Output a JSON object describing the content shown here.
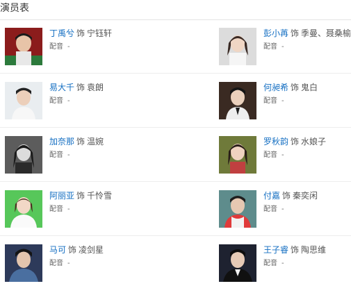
{
  "section": {
    "title": "演员表"
  },
  "cast": [
    {
      "actor": "丁禹兮",
      "plays": "饰",
      "role": "宁钰轩",
      "dub_label": "配音",
      "dub_value": "-",
      "photo_bg": "#8b1c1c"
    },
    {
      "actor": "彭小苒",
      "plays": "饰",
      "role": "季曼、聂桑榆",
      "dub_label": "配音",
      "dub_value": "-",
      "photo_bg": "#dcdcdc"
    },
    {
      "actor": "易大千",
      "plays": "饰",
      "role": "袁朗",
      "dub_label": "配音",
      "dub_value": "-",
      "photo_bg": "#e9edf0"
    },
    {
      "actor": "何昶希",
      "plays": "饰",
      "role": "鬼白",
      "dub_label": "配音",
      "dub_value": "-",
      "photo_bg": "#3a2a22"
    },
    {
      "actor": "加奈那",
      "plays": "饰",
      "role": "温婉",
      "dub_label": "配音",
      "dub_value": "-",
      "photo_bg": "#5c5c5c"
    },
    {
      "actor": "罗秋韵",
      "plays": "饰",
      "role": "水娘子",
      "dub_label": "配音",
      "dub_value": "-",
      "photo_bg": "#6f7a3a"
    },
    {
      "actor": "阿丽亚",
      "plays": "饰",
      "role": "千怜雪",
      "dub_label": "配音",
      "dub_value": "-",
      "photo_bg": "#57c75a"
    },
    {
      "actor": "付嘉",
      "plays": "饰",
      "role": "秦奕闲",
      "dub_label": "配音",
      "dub_value": "-",
      "photo_bg": "#5e8c8c"
    },
    {
      "actor": "马可",
      "plays": "饰",
      "role": "凌剑星",
      "dub_label": "配音",
      "dub_value": "-",
      "photo_bg": "#2d3a5a"
    },
    {
      "actor": "王子睿",
      "plays": "饰",
      "role": "陶思维",
      "dub_label": "配音",
      "dub_value": "-",
      "photo_bg": "#1e2230"
    }
  ]
}
